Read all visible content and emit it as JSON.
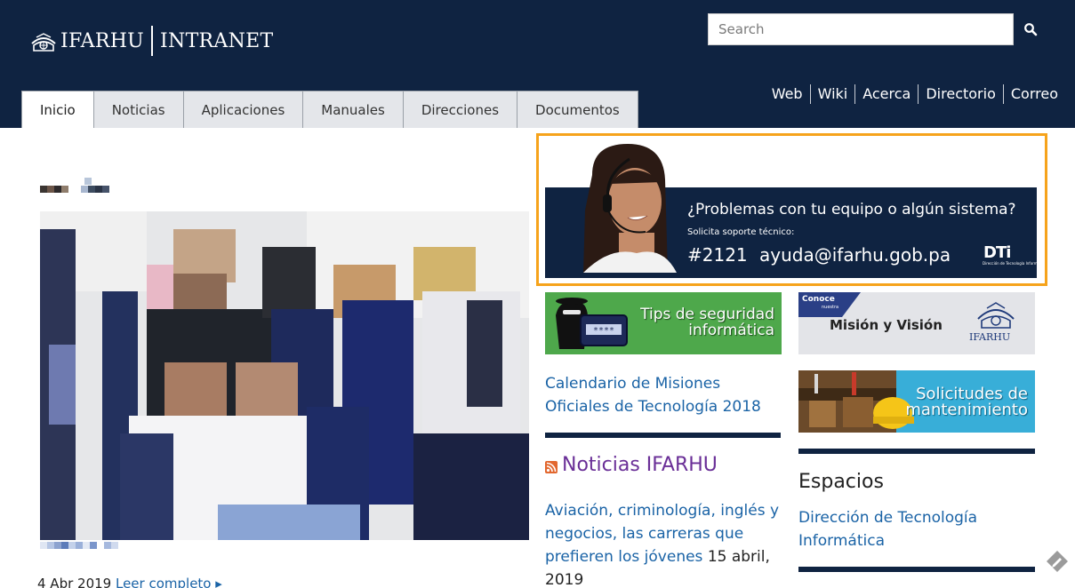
{
  "header": {
    "logo_name": "IFARHU",
    "logo_suffix": "INTRANET",
    "search": {
      "placeholder": "Search",
      "value": ""
    },
    "search_icon": "search-icon",
    "tabs": [
      {
        "label": "Inicio",
        "active": true
      },
      {
        "label": "Noticias"
      },
      {
        "label": "Aplicaciones"
      },
      {
        "label": "Manuales"
      },
      {
        "label": "Direcciones"
      },
      {
        "label": "Documentos"
      }
    ],
    "links": [
      "Web",
      "Wiki",
      "Acerca",
      "Directorio",
      "Correo"
    ]
  },
  "main": {
    "caption_date": "4 Abr 2019",
    "caption_link": "Leer completo"
  },
  "support_banner": {
    "question": "¿Problemas con tu equipo o algún sistema?",
    "subtitle": "Solicita soporte técnico:",
    "extension": "#2121",
    "email": "ayuda@ifarhu.gob.pa",
    "brand": "DTi",
    "brand_sub": "Dirección de Tecnología Informática"
  },
  "tips_banner": {
    "line1": "Tips de seguridad",
    "line2": "informática",
    "password_mask": "****"
  },
  "calendar_link": "Calendario de Misiones Oficiales de Tecnología 2018",
  "news": {
    "title": "Noticias IFARHU",
    "item_link": "Aviación, criminología, inglés y negocios, las carreras que prefieren los jóvenes",
    "item_date": "15 abril, 2019"
  },
  "mision_banner": {
    "conoce": "Conoce",
    "nuestra": "nuestra",
    "title": "Misión y Visión",
    "logo": "IFARHU"
  },
  "solicitudes_banner": {
    "line1": "Solicitudes de",
    "line2": "mantenimiento"
  },
  "espacios": {
    "title": "Espacios",
    "link": "Dirección de Tecnología Informática"
  },
  "colors": {
    "navy": "#0f2341",
    "accent_orange": "#f6a31b",
    "link_blue": "#1a63a6",
    "news_purple": "#6a2f97",
    "tips_green": "#4ea84b",
    "solicitudes_blue": "#38aed8"
  }
}
